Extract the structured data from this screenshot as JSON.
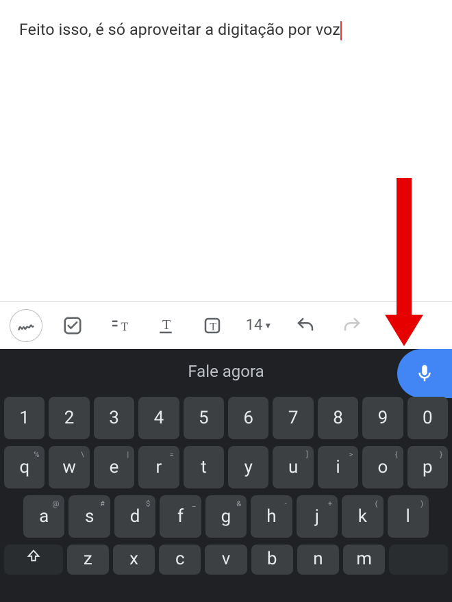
{
  "editor": {
    "text": "Feito isso, é só aproveitar a digitação por voz"
  },
  "toolbar": {
    "font_size": "14"
  },
  "keyboard": {
    "speak_label": "Fale agora",
    "row_numbers": [
      "1",
      "2",
      "3",
      "4",
      "5",
      "6",
      "7",
      "8",
      "9",
      "0"
    ],
    "row_qwerty": [
      {
        "k": "q",
        "s": "%"
      },
      {
        "k": "w",
        "s": "\\"
      },
      {
        "k": "e",
        "s": "|"
      },
      {
        "k": "r",
        "s": "="
      },
      {
        "k": "t",
        "s": ""
      },
      {
        "k": "y",
        "s": ""
      },
      {
        "k": "u",
        "s": "]"
      },
      {
        "k": "i",
        "s": ">"
      },
      {
        "k": "o",
        "s": "{"
      },
      {
        "k": "p",
        "s": "}"
      }
    ],
    "row_asdf": [
      {
        "k": "a",
        "s": "@"
      },
      {
        "k": "s",
        "s": "#"
      },
      {
        "k": "d",
        "s": "$"
      },
      {
        "k": "f",
        "s": "_"
      },
      {
        "k": "g",
        "s": "&"
      },
      {
        "k": "h",
        "s": "-"
      },
      {
        "k": "j",
        "s": "+"
      },
      {
        "k": "k",
        "s": "("
      },
      {
        "k": "l",
        "s": ")"
      }
    ],
    "row_zxcv": [
      "z",
      "x",
      "c",
      "v",
      "b",
      "n",
      "m"
    ]
  },
  "colors": {
    "accent_blue": "#4285f4",
    "annotation_red": "#e60000",
    "cursor_red": "#e53935",
    "kbd_bg": "#202124",
    "key_bg": "#3c4043"
  }
}
